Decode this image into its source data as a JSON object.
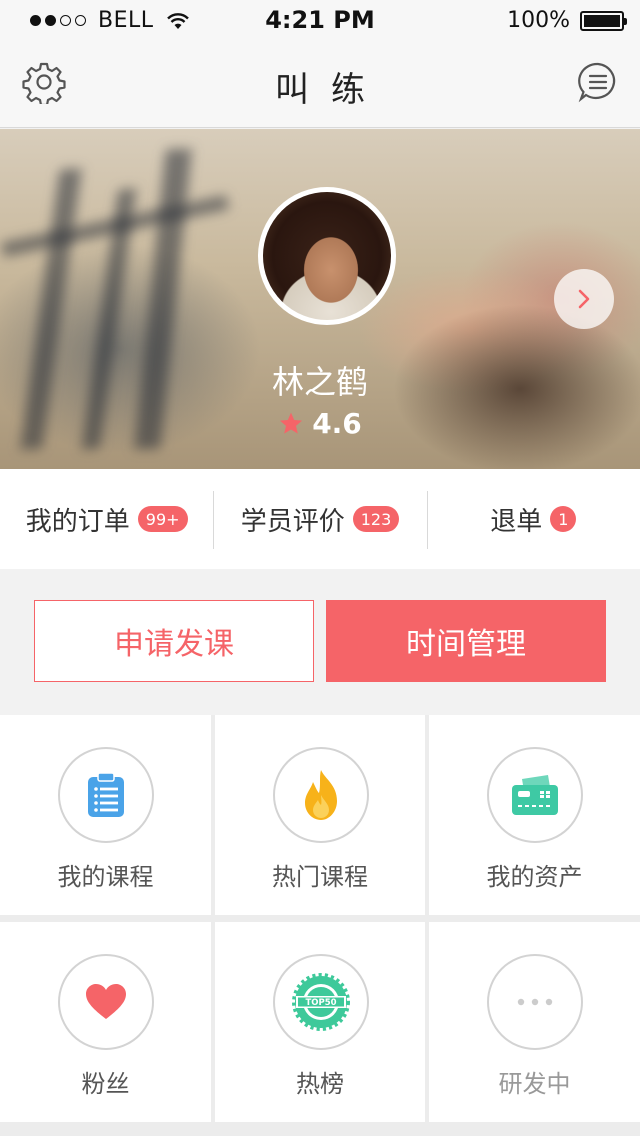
{
  "status_bar": {
    "signal_dots": [
      true,
      true,
      false,
      false
    ],
    "carrier": "BELL",
    "time": "4:21 PM",
    "battery_percent": "100%",
    "battery_level": 1.0
  },
  "nav": {
    "title": "叫练",
    "left_icon": "gear-icon",
    "right_icon": "message-icon"
  },
  "profile": {
    "name": "林之鹤",
    "rating": "4.6"
  },
  "stats": [
    {
      "label": "我的订单",
      "badge": "99+"
    },
    {
      "label": "学员评价",
      "badge": "123"
    },
    {
      "label": "退单",
      "badge": "1"
    }
  ],
  "actions": {
    "primary_outline": "申请发课",
    "primary_solid": "时间管理"
  },
  "grid": [
    {
      "label": "我的课程",
      "icon": "clipboard-icon"
    },
    {
      "label": "热门课程",
      "icon": "flame-icon"
    },
    {
      "label": "我的资产",
      "icon": "wallet-icon"
    },
    {
      "label": "粉丝",
      "icon": "heart-icon"
    },
    {
      "label": "热榜",
      "icon": "top50-badge-icon",
      "badge_text": "TOP50"
    },
    {
      "label": "研发中",
      "icon": "more-dots-icon"
    }
  ],
  "colors": {
    "accent": "#f56468",
    "clipboard": "#4aa3e8",
    "flame": "#f7b21a",
    "wallet": "#3ec9a4",
    "heart": "#f56468",
    "top50": "#3ec99a"
  }
}
